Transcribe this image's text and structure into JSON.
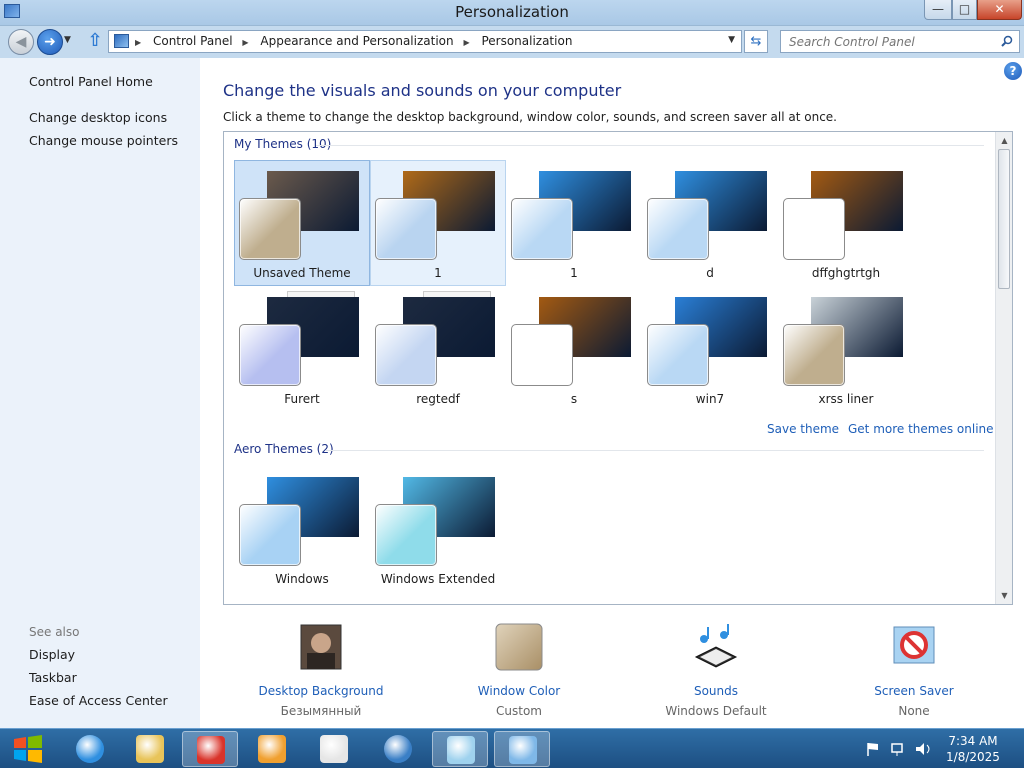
{
  "window": {
    "title": "Personalization"
  },
  "address": {
    "crumbs": [
      "Control Panel",
      "Appearance and Personalization",
      "Personalization"
    ],
    "search_placeholder": "Search Control Panel"
  },
  "left_nav": {
    "home": "Control Panel Home",
    "links": [
      "Change desktop icons",
      "Change mouse pointers"
    ],
    "see_also_title": "See also",
    "see_also": [
      "Display",
      "Taskbar",
      "Ease of Access Center"
    ]
  },
  "main": {
    "heading": "Change the visuals and sounds on your computer",
    "subheading": "Click a theme to change the desktop background, window color, sounds, and screen saver all at once.",
    "my_themes_label": "My Themes (10)",
    "aero_themes_label": "Aero Themes (2)",
    "save_theme": "Save theme",
    "get_more": "Get more themes online",
    "my_themes": [
      {
        "name": "Unsaved Theme",
        "wall": "#6b5a4c",
        "swatch": "#bfae8e",
        "state": "selected"
      },
      {
        "name": "1",
        "wall": "#b06a18",
        "swatch": "#b9d4f0",
        "state": "hover"
      },
      {
        "name": "1",
        "wall": "#2f8fe0",
        "swatch": "#b9d8f4",
        "state": ""
      },
      {
        "name": "d",
        "wall": "#2f8fe0",
        "swatch": "#b9d8f4",
        "state": ""
      },
      {
        "name": "dffghgtrtgh",
        "wall": "#a35a12",
        "swatch": "#ffffff",
        "state": ""
      },
      {
        "name": "Furert",
        "wall": "#1d2a40",
        "swatch": "#b6bff0",
        "state": "stack"
      },
      {
        "name": "regtedf",
        "wall": "#1d2a40",
        "swatch": "#c4d6f2",
        "state": "stack"
      },
      {
        "name": "s",
        "wall": "#a35a12",
        "swatch": "#ffffff",
        "state": ""
      },
      {
        "name": "win7",
        "wall": "#2a7fd6",
        "swatch": "#b9d8f4",
        "state": ""
      },
      {
        "name": "xrss liner",
        "wall": "#c9d2d8",
        "swatch": "#bfae8e",
        "state": ""
      }
    ],
    "aero_themes": [
      {
        "name": "Windows",
        "wall": "#2f8fe0",
        "swatch": "#a8d2f4"
      },
      {
        "name": "Windows Extended",
        "wall": "#52b9e6",
        "swatch": "#8fdcea"
      }
    ]
  },
  "settings": [
    {
      "label": "Desktop Background",
      "value": "Безымянный",
      "icon": "desktop-background-icon"
    },
    {
      "label": "Window Color",
      "value": "Custom",
      "icon": "window-color-icon"
    },
    {
      "label": "Sounds",
      "value": "Windows Default",
      "icon": "sounds-icon"
    },
    {
      "label": "Screen Saver",
      "value": "None",
      "icon": "screen-saver-icon"
    }
  ],
  "taskbar": {
    "apps": [
      "internet-explorer-icon",
      "file-explorer-icon",
      "app-red-icon",
      "media-player-icon",
      "document-icon",
      "browser-globe-icon",
      "notepad-icon",
      "control-panel-icon"
    ],
    "time": "7:34 AM",
    "date": "1/8/2025"
  },
  "colors": {
    "link": "#1f5fb8",
    "heading": "#1e3287",
    "selected": "#cfe3f8"
  }
}
